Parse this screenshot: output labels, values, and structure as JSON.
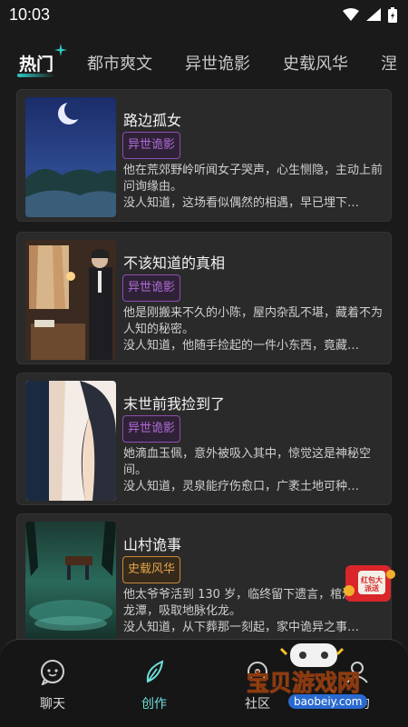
{
  "status": {
    "time": "10:03"
  },
  "tabs": [
    {
      "label": "热门",
      "active": true
    },
    {
      "label": "都市爽文",
      "active": false
    },
    {
      "label": "异世诡影",
      "active": false
    },
    {
      "label": "史载风华",
      "active": false
    },
    {
      "label": "涅",
      "active": false
    }
  ],
  "stories": [
    {
      "title": "路边孤女",
      "tag": "异世诡影",
      "tag_style": "purple",
      "desc": "他在荒郊野岭听闻女子哭声，心生恻隐，主动上前问询缘由。",
      "desc2": "没人知道，这场看似偶然的相遇，早已埋下…"
    },
    {
      "title": "不该知道的真相",
      "tag": "异世诡影",
      "tag_style": "purple",
      "desc": "他是刚搬来不久的小陈，屋内杂乱不堪，藏着不为人知的秘密。",
      "desc2": "没人知道，他随手捡起的一件小东西，竟藏…"
    },
    {
      "title": "末世前我捡到了",
      "tag": "异世诡影",
      "tag_style": "purple",
      "desc": "她滴血玉佩，意外被吸入其中，惊觉这是神秘空间。",
      "desc2": "没人知道，灵泉能疗伤愈口，广袤土地可种…"
    },
    {
      "title": "山村诡事",
      "tag": "史载风华",
      "tag_style": "orange",
      "desc": "他太爷爷活到 130 岁，临终留下遗言，棺沉入黑龙潭，吸取地脉化龙。",
      "desc2": "没人知道，从下葬那一刻起，家中诡异之事…"
    }
  ],
  "nav": [
    {
      "label": "聊天",
      "icon": "chat-icon"
    },
    {
      "label": "创作",
      "icon": "feather-icon",
      "active": true
    },
    {
      "label": "社区",
      "icon": "community-icon"
    },
    {
      "label": "我的",
      "icon": "profile-icon"
    }
  ],
  "promo": {
    "text": "红包大派送"
  },
  "watermark": {
    "title": "宝贝游戏网",
    "url": "baobeiy.com"
  },
  "colors": {
    "accent": "#2ec9c4",
    "purple_tag": "#b06ad8",
    "orange_tag": "#e0a24a"
  }
}
